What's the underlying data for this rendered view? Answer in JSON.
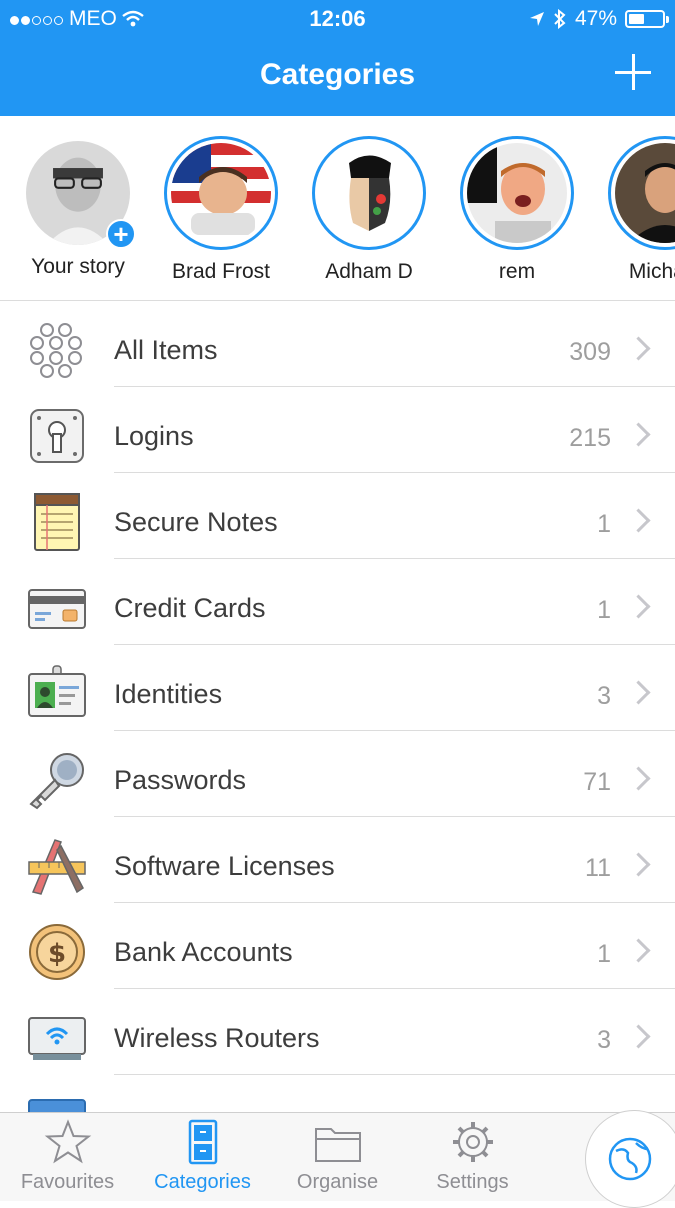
{
  "status": {
    "carrier": "MEO",
    "time": "12:06",
    "battery": "47%",
    "battery_level": 0.47
  },
  "nav": {
    "title": "Categories",
    "add_icon": "plus-icon"
  },
  "stories": [
    {
      "name": "Your story",
      "own": true
    },
    {
      "name": "Brad Frost"
    },
    {
      "name": "Adham D"
    },
    {
      "name": "rem"
    },
    {
      "name": "Michael"
    }
  ],
  "categories": [
    {
      "label": "All Items",
      "count": "309",
      "icon": "all-items-icon"
    },
    {
      "label": "Logins",
      "count": "215",
      "icon": "keyhole-icon"
    },
    {
      "label": "Secure Notes",
      "count": "1",
      "icon": "notepad-icon"
    },
    {
      "label": "Credit Cards",
      "count": "1",
      "icon": "credit-card-icon"
    },
    {
      "label": "Identities",
      "count": "3",
      "icon": "id-badge-icon"
    },
    {
      "label": "Passwords",
      "count": "71",
      "icon": "key-icon"
    },
    {
      "label": "Software Licenses",
      "count": "11",
      "icon": "tools-icon"
    },
    {
      "label": "Bank Accounts",
      "count": "1",
      "icon": "coin-icon"
    },
    {
      "label": "Wireless Routers",
      "count": "3",
      "icon": "router-icon"
    }
  ],
  "tabs": [
    {
      "label": "Favourites",
      "icon": "star-icon"
    },
    {
      "label": "Categories",
      "icon": "cabinet-icon",
      "active": true
    },
    {
      "label": "Organise",
      "icon": "folder-icon"
    },
    {
      "label": "Settings",
      "icon": "gear-icon"
    }
  ],
  "colors": {
    "accent": "#2196F3",
    "count": "#9e9e9e",
    "label": "#3d3d3d"
  }
}
